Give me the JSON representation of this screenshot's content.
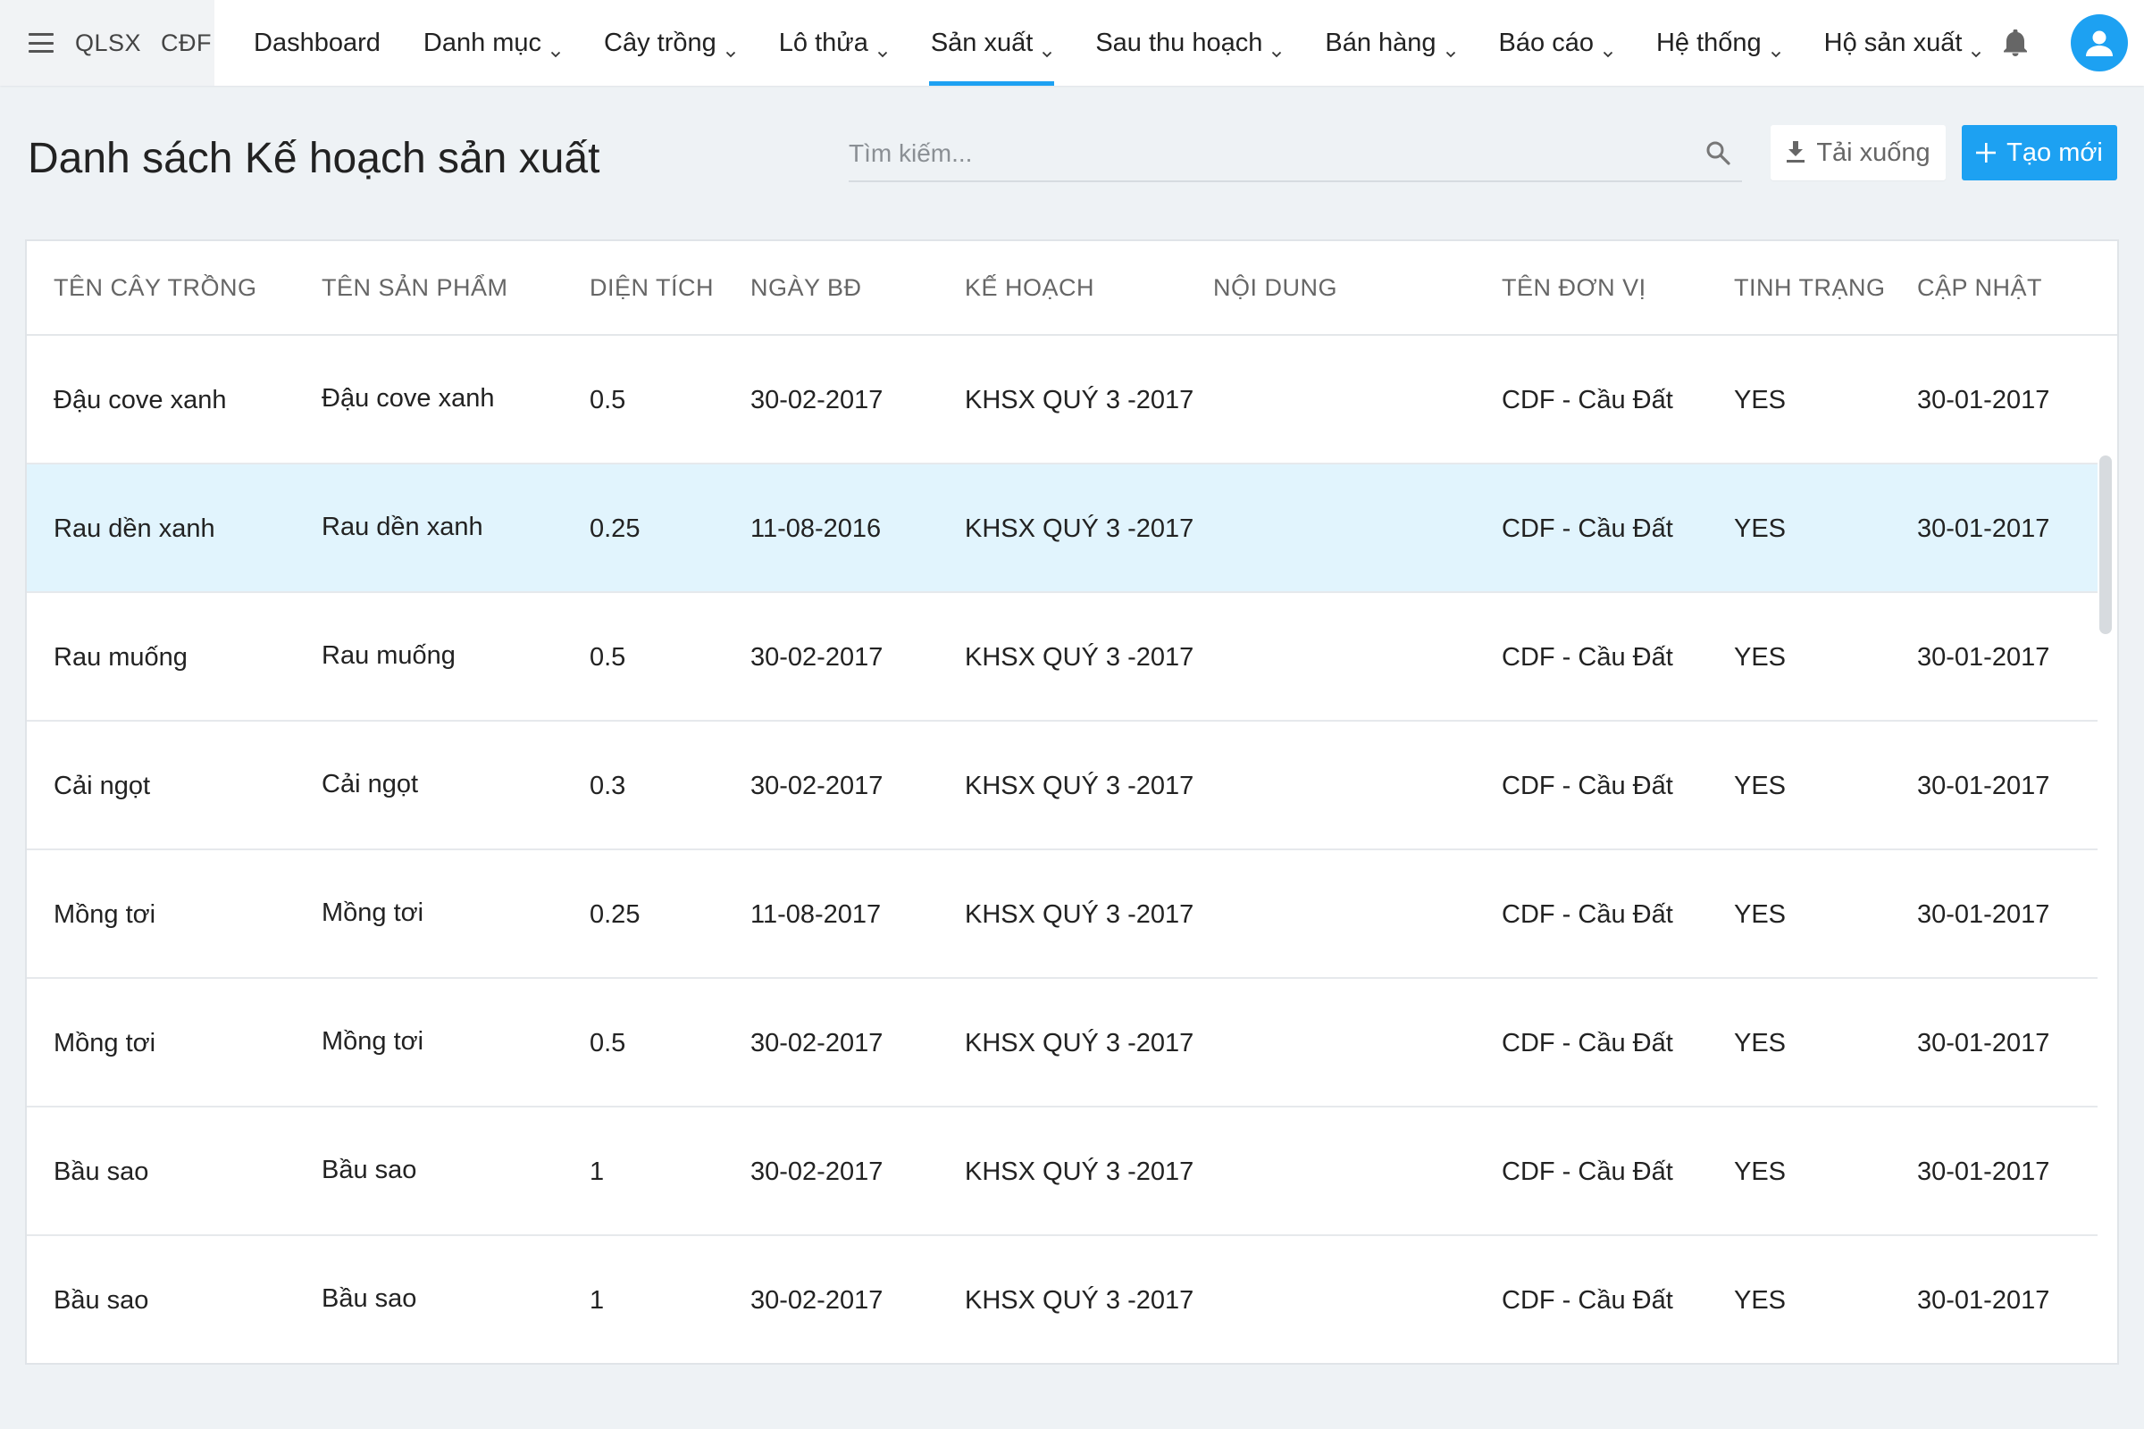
{
  "brand": {
    "part1": "QLSX",
    "part2": "CĐF"
  },
  "nav": [
    {
      "label": "Dashboard",
      "has_dropdown": false,
      "active": false
    },
    {
      "label": "Danh mục",
      "has_dropdown": true,
      "active": false
    },
    {
      "label": "Cây trồng",
      "has_dropdown": true,
      "active": false
    },
    {
      "label": "Lô thửa",
      "has_dropdown": true,
      "active": false
    },
    {
      "label": "Sản xuất",
      "has_dropdown": true,
      "active": true
    },
    {
      "label": "Sau thu hoạch",
      "has_dropdown": true,
      "active": false
    },
    {
      "label": "Bán hàng",
      "has_dropdown": true,
      "active": false
    },
    {
      "label": "Báo cáo",
      "has_dropdown": true,
      "active": false
    },
    {
      "label": "Hệ thống",
      "has_dropdown": true,
      "active": false
    },
    {
      "label": "Hộ sản xuất",
      "has_dropdown": true,
      "active": false
    }
  ],
  "icons": {
    "menu": "hamburger-icon",
    "bell": "bell-icon",
    "avatar": "user-icon",
    "search": "search-icon",
    "download": "download-icon",
    "add": "plus-icon",
    "chevron": "chevron-down-icon"
  },
  "colors": {
    "accent": "#1da1f2",
    "selected_row": "#e1f4fd",
    "page_bg": "#eef2f5"
  },
  "page": {
    "title": "Danh sách Kế hoạch sản xuất",
    "search_placeholder": "Tìm kiếm...",
    "download_label": "Tải xuống",
    "create_label": "Tạo mới"
  },
  "table": {
    "columns": [
      "TÊN CÂY TRỒNG",
      "TÊN SẢN PHẨM",
      "DIỆN TÍCH",
      "NGÀY BĐ",
      "KẾ HOẠCH",
      "NỘI DUNG",
      "TÊN ĐƠN VỊ",
      "TINH TRẠNG",
      "CẬP NHẬT"
    ],
    "selected_row": 1,
    "rows": [
      [
        "Đậu cove xanh",
        "Đậu cove xanh",
        "0.5",
        "30-02-2017",
        "KHSX QUÝ 3 -2017",
        "",
        "CDF - Cầu Đất",
        "YES",
        "30-01-2017"
      ],
      [
        "Rau dền xanh",
        "Rau dền xanh",
        "0.25",
        "11-08-2016",
        "KHSX QUÝ 3 -2017",
        "",
        "CDF - Cầu Đất",
        "YES",
        "30-01-2017"
      ],
      [
        "Rau muống",
        "Rau muống",
        "0.5",
        "30-02-2017",
        "KHSX QUÝ 3 -2017",
        "",
        "CDF - Cầu Đất",
        "YES",
        "30-01-2017"
      ],
      [
        "Cải ngọt",
        "Cải ngọt",
        "0.3",
        "30-02-2017",
        "KHSX QUÝ 3 -2017",
        "",
        "CDF - Cầu Đất",
        "YES",
        "30-01-2017"
      ],
      [
        "Mồng tơi",
        "Mồng tơi",
        "0.25",
        "11-08-2017",
        "KHSX QUÝ 3 -2017",
        "",
        "CDF - Cầu Đất",
        "YES",
        "30-01-2017"
      ],
      [
        "Mồng tơi",
        "Mồng tơi",
        "0.5",
        "30-02-2017",
        "KHSX QUÝ 3 -2017",
        "",
        "CDF - Cầu Đất",
        "YES",
        "30-01-2017"
      ],
      [
        "Bầu sao",
        "Bầu sao",
        "1",
        "30-02-2017",
        "KHSX QUÝ 3 -2017",
        "",
        "CDF - Cầu Đất",
        "YES",
        "30-01-2017"
      ],
      [
        "Bầu sao",
        "Bầu sao",
        "1",
        "30-02-2017",
        "KHSX QUÝ 3 -2017",
        "",
        "CDF - Cầu Đất",
        "YES",
        "30-01-2017"
      ]
    ]
  }
}
